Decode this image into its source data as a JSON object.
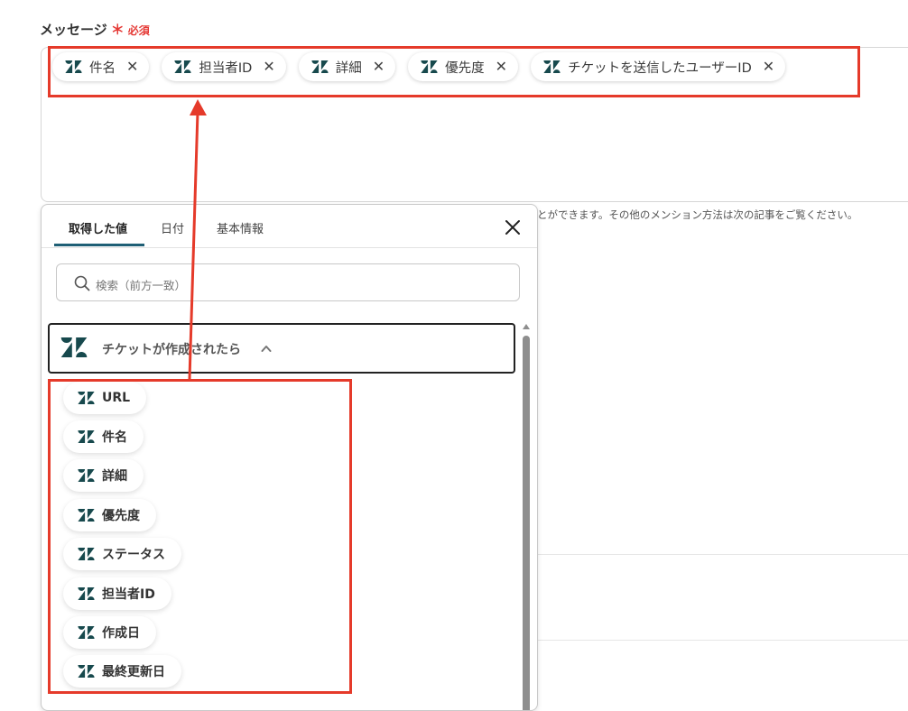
{
  "field": {
    "label": "メッセージ",
    "required_mark": "＊",
    "required_text": "必須"
  },
  "hint": "とができます。その他のメンション方法は次の記事をご覧ください。",
  "selected_chips": [
    {
      "label": "件名"
    },
    {
      "label": "担当者ID"
    },
    {
      "label": "詳細"
    },
    {
      "label": "優先度"
    },
    {
      "label": "チケットを送信したユーザーID"
    }
  ],
  "panel": {
    "tabs": [
      {
        "label": "取得した値",
        "active": true
      },
      {
        "label": "日付",
        "active": false
      },
      {
        "label": "基本情報",
        "active": false
      }
    ],
    "search_placeholder": "検索（前方一致）",
    "section_title": "チケットが作成されたら",
    "items": [
      {
        "label": "URL"
      },
      {
        "label": "件名"
      },
      {
        "label": "詳細"
      },
      {
        "label": "優先度"
      },
      {
        "label": "ステータス"
      },
      {
        "label": "担当者ID"
      },
      {
        "label": "作成日"
      },
      {
        "label": "最終更新日"
      }
    ]
  },
  "icons": {
    "chip_icon": "zendesk-icon",
    "close": "close-icon",
    "search": "search-icon",
    "caret": "chevron-up-icon"
  },
  "colors": {
    "accent": "#1f5f75",
    "required": "#e53935",
    "highlight": "#e53a2a",
    "zendesk": "#17494d"
  }
}
